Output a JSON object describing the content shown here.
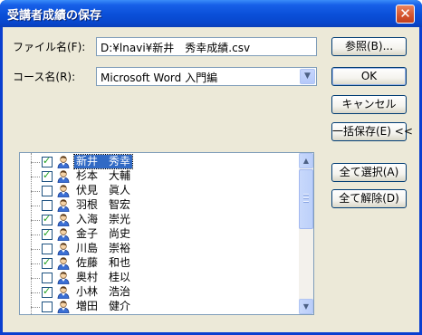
{
  "window": {
    "title": "受講者成績の保存",
    "close_glyph": "✕"
  },
  "filename": {
    "label": "ファイル名(F):",
    "value": "D:¥lnavi¥新井　秀幸成績.csv"
  },
  "course": {
    "label": "コース名(R):",
    "value": "Microsoft Word 入門編"
  },
  "buttons": {
    "browse": "参照(B)...",
    "ok": "OK",
    "cancel": "キャンセル",
    "bulk_save": "一括保存(E) <<",
    "select_all": "全て選択(A)",
    "clear_all": "全て解除(D)"
  },
  "students": [
    {
      "name": "新井　秀幸",
      "checked": true,
      "selected": true
    },
    {
      "name": "杉本　大輔",
      "checked": true,
      "selected": false
    },
    {
      "name": "伏見　眞人",
      "checked": false,
      "selected": false
    },
    {
      "name": "羽根　智宏",
      "checked": false,
      "selected": false
    },
    {
      "name": "入海　崇光",
      "checked": true,
      "selected": false
    },
    {
      "name": "金子　尚史",
      "checked": true,
      "selected": false
    },
    {
      "name": "川島　崇裕",
      "checked": false,
      "selected": false
    },
    {
      "name": "佐藤　和也",
      "checked": true,
      "selected": false
    },
    {
      "name": "奥村　桂以",
      "checked": false,
      "selected": false
    },
    {
      "name": "小林　浩治",
      "checked": true,
      "selected": false
    },
    {
      "name": "増田　健介",
      "checked": false,
      "selected": false
    }
  ],
  "colors": {
    "title_bar": "#0a4fd8",
    "dialog_bg": "#ece9d8",
    "selection": "#316ac5",
    "check": "#21a121"
  },
  "icons": {
    "row_icon": "person-icon",
    "scroll_up": "scroll-up-arrow-icon",
    "scroll_down": "scroll-down-arrow-icon",
    "combo_arrow": "chevron-down-icon"
  }
}
